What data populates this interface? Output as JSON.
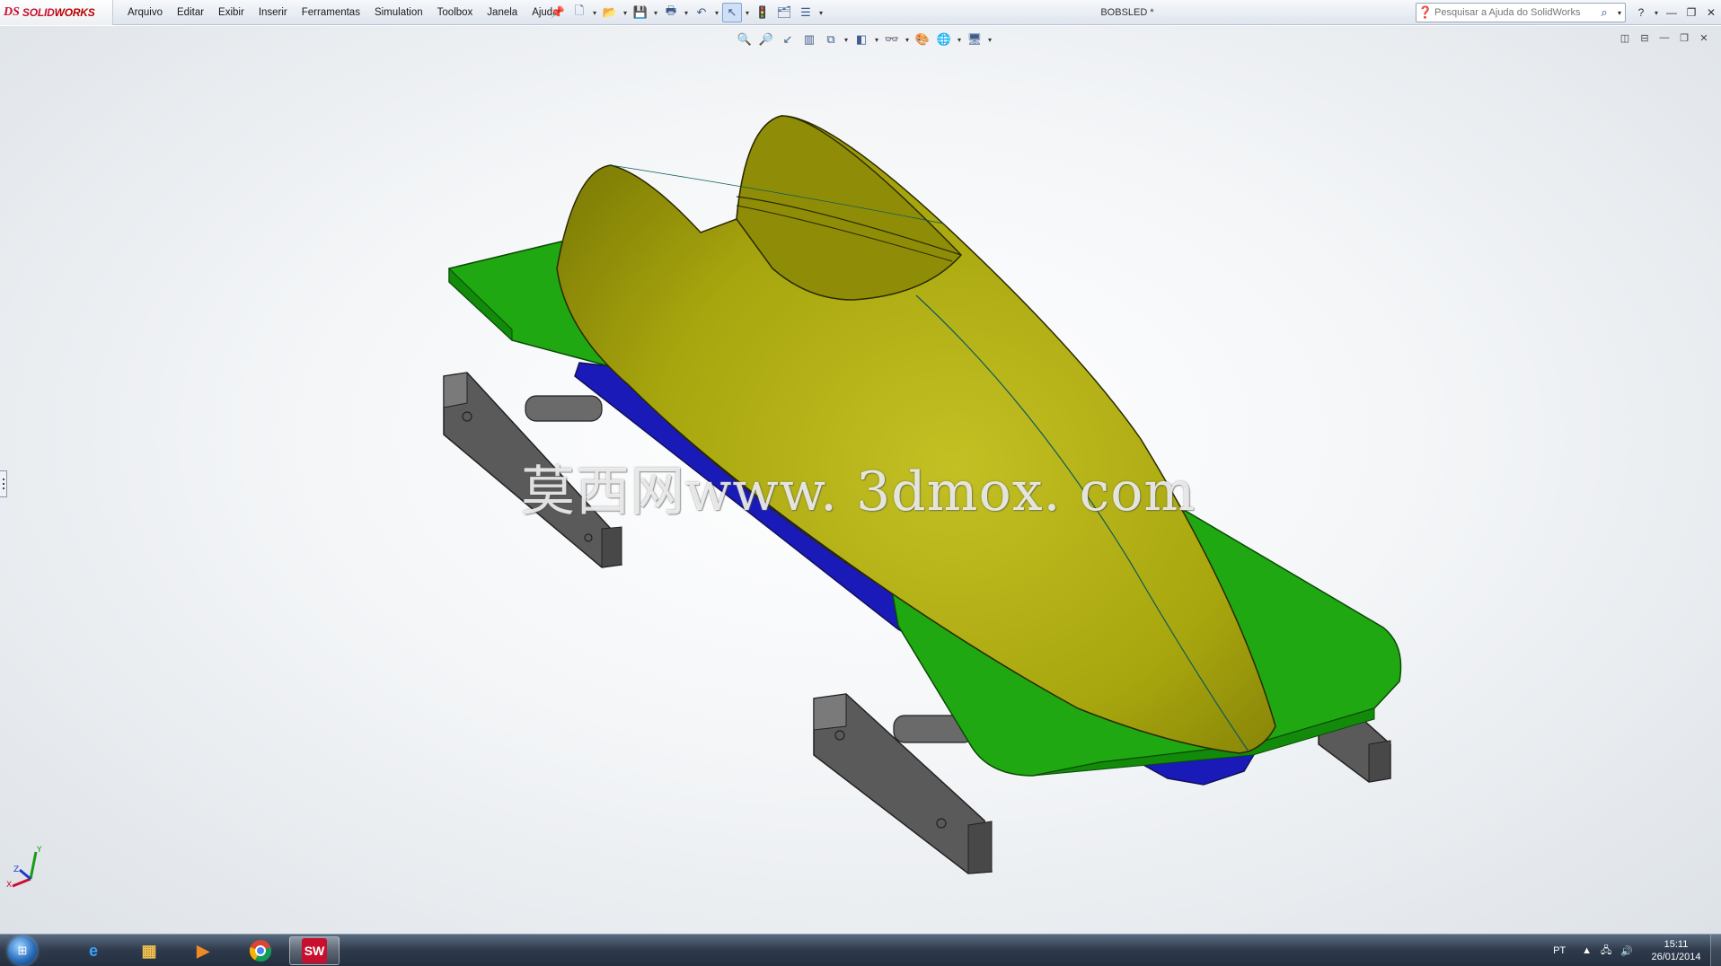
{
  "app": {
    "logo_ds": "DS",
    "logo_brand_a": "SOLID",
    "logo_brand_b": "WORKS",
    "doc_title": "BOBSLED *"
  },
  "menu": [
    "Arquivo",
    "Editar",
    "Exibir",
    "Inserir",
    "Ferramentas",
    "Simulation",
    "Toolbox",
    "Janela",
    "Ajuda"
  ],
  "search": {
    "placeholder": "Pesquisar a Ajuda do SolidWorks"
  },
  "watermark": "莫西网www. 3dmox. com",
  "triad": {
    "x": "X",
    "y": "Y",
    "z": "Z"
  },
  "taskbar": {
    "lang": "PT",
    "time": "15:11",
    "date": "26/01/2014"
  },
  "colors": {
    "body": "#a8a60e",
    "deck": "#1fa812",
    "hull": "#1a1ab8",
    "runner": "#5f5f5f",
    "accent": "#c8102e"
  }
}
